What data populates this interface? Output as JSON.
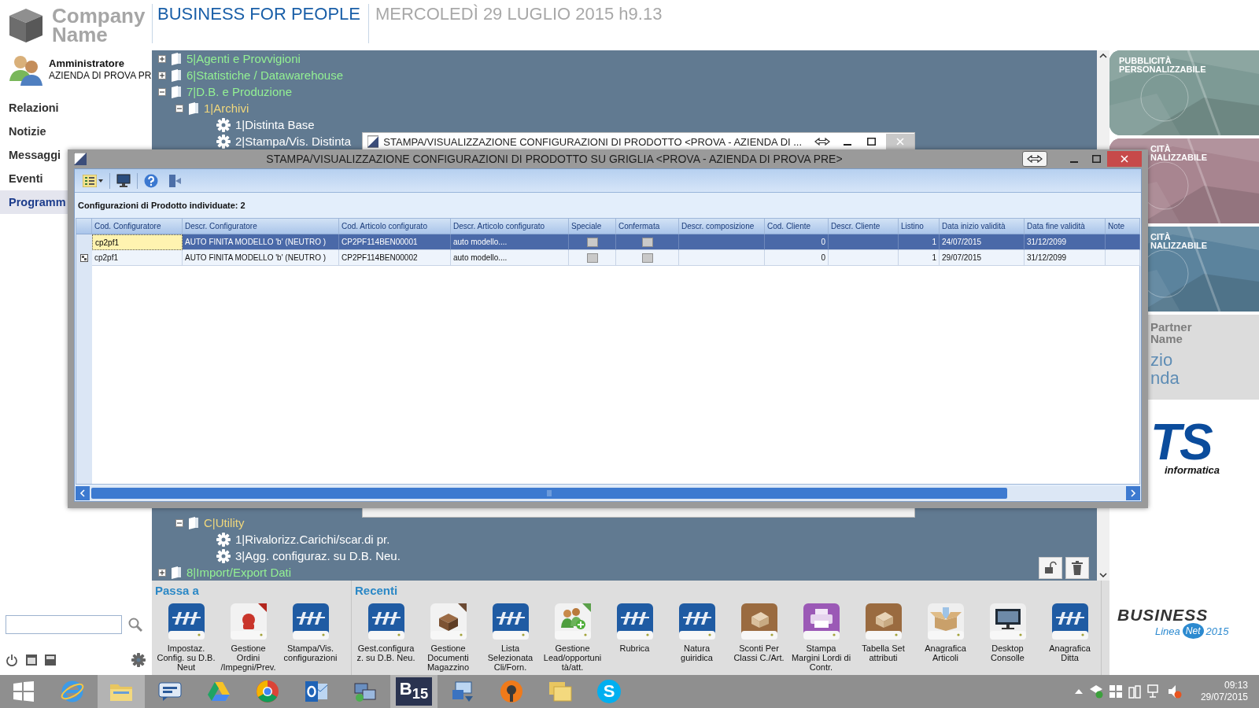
{
  "company_name": "Company Name",
  "header": {
    "slogan": "BUSINESS FOR PEOPLE",
    "date": "MERCOLEDÌ 29 LUGLIO 2015 h9.13"
  },
  "user": {
    "name": "Amministratore",
    "company": "AZIENDA DI PROVA PR"
  },
  "nav": [
    {
      "label": "Relazioni",
      "selected": false
    },
    {
      "label": "Notizie",
      "selected": false
    },
    {
      "label": "Messaggi",
      "selected": false
    },
    {
      "label": "Eventi",
      "selected": false
    },
    {
      "label": "Programm",
      "selected": true
    }
  ],
  "tree": {
    "items": [
      {
        "kind": "folder",
        "label": "5|Agenti e Provvigioni",
        "expanded": false
      },
      {
        "kind": "folder",
        "label": "6|Statistiche / Datawarehouse",
        "expanded": false
      },
      {
        "kind": "folder",
        "label": "7|D.B. e Produzione",
        "expanded": true,
        "children": [
          {
            "kind": "folder",
            "label": "1|Archivi",
            "expanded": true,
            "children": [
              {
                "kind": "program",
                "label": "1|Distinta Base"
              },
              {
                "kind": "program",
                "label": "2|Stampa/Vis. Distinta"
              }
            ]
          },
          {
            "kind": "folder",
            "label": "C|Utility",
            "expanded": true,
            "children": [
              {
                "kind": "program",
                "label": "1|Rivalorizz.Carichi/scar.di pr."
              },
              {
                "kind": "program",
                "label": "3|Agg. configuraz. su D.B. Neu."
              }
            ]
          }
        ]
      },
      {
        "kind": "folder",
        "label": "8|Import/Export Dati",
        "expanded": false
      }
    ]
  },
  "back_window": {
    "title": "STAMPA/VISUALIZZAZIONE CONFIGURAZIONI DI PRODOTTO <PROVA - AZIENDA DI ..."
  },
  "dialog": {
    "title": "STAMPA/VISUALIZZAZIONE CONFIGURAZIONI DI PRODOTTO SU GRIGLIA <PROVA - AZIENDA DI PROVA PRE>",
    "summary": "**Configurazioni di Prodotto individuate:  2**",
    "columns": [
      {
        "label": "Cod. Configuratore",
        "kind": "text"
      },
      {
        "label": "Descr. Configuratore",
        "kind": "text"
      },
      {
        "label": "Cod. Articolo configurato",
        "kind": "text"
      },
      {
        "label": "Descr. Articolo configurato",
        "kind": "text"
      },
      {
        "label": "Speciale",
        "kind": "check"
      },
      {
        "label": "Confermata",
        "kind": "check"
      },
      {
        "label": "Descr. composizione",
        "kind": "text"
      },
      {
        "label": "Cod. Cliente",
        "kind": "number"
      },
      {
        "label": "Descr. Cliente",
        "kind": "text"
      },
      {
        "label": "Listino",
        "kind": "number"
      },
      {
        "label": "Data inizio validità",
        "kind": "text"
      },
      {
        "label": "Data fine validità",
        "kind": "text"
      },
      {
        "label": "Note",
        "kind": "text"
      }
    ],
    "rows": [
      {
        "selected": true,
        "current": true,
        "cells": [
          "cp2pf1",
          "AUTO FINITA MODELLO 'b' (NEUTRO )",
          "CP2PF114BEN00001",
          "auto modello....",
          false,
          false,
          null,
          "0",
          null,
          "1",
          "24/07/2015",
          "31/12/2099",
          null
        ]
      },
      {
        "selected": false,
        "current": false,
        "cells": [
          "cp2pf1",
          "AUTO FINITA MODELLO 'b' (NEUTRO )",
          "CP2PF114BEN00002",
          "auto modello....",
          false,
          false,
          null,
          "0",
          null,
          "1",
          "29/07/2015",
          "31/12/2099",
          null
        ]
      }
    ]
  },
  "dock": [
    {
      "title": "Passa a",
      "items": [
        {
          "label": "Impostaz. Config. su D.B. Neut",
          "kind": "tile"
        },
        {
          "label": "Gestione Ordini /Impegni/Prev.",
          "kind": "order"
        },
        {
          "label": "Stampa/Vis. configurazioni",
          "kind": "tile"
        }
      ]
    },
    {
      "title": "Recenti",
      "items": [
        {
          "label": "Gest.configuraz. su D.B. Neu.",
          "kind": "tile"
        },
        {
          "label": "Gestione Documenti Magazzino",
          "kind": "boxdoc"
        },
        {
          "label": "Lista Selezionata Cli/Forn.",
          "kind": "tile"
        },
        {
          "label": "Gestione Lead/opportunità/att.",
          "kind": "people"
        },
        {
          "label": "Rubrica",
          "kind": "tile"
        },
        {
          "label": "Natura guiridica",
          "kind": "tile"
        },
        {
          "label": "Sconti Per Classi C./Art.",
          "kind": "brownbox"
        },
        {
          "label": "Stampa Margini Lordi di Contr.",
          "kind": "printer"
        },
        {
          "label": "Tabella Set attributi",
          "kind": "brownbox"
        },
        {
          "label": "Anagrafica Articoli",
          "kind": "openbox"
        },
        {
          "label": "Desktop Consolle",
          "kind": "monitor"
        },
        {
          "label": "Anagrafica Ditta",
          "kind": "tile"
        }
      ]
    }
  ],
  "ads": [
    {
      "kind": "promo",
      "color": "#7d9a95",
      "lines": [
        "PUBBLICITÀ",
        "PERSONALIZZABILE"
      ]
    },
    {
      "kind": "promo",
      "color": "#a88590",
      "lines": [
        "CITÀ",
        "NALIZZABILE"
      ]
    },
    {
      "kind": "promo",
      "color": "#5b839d",
      "lines": [
        "CITÀ",
        "NALIZZABILE"
      ]
    },
    {
      "kind": "partner",
      "color": "#dcdcdc",
      "lines": [
        "Partner",
        "Name"
      ],
      "sub_lines": [
        "zio",
        "nda"
      ]
    }
  ],
  "vendor_logo": {
    "mark": "TS",
    "caption": "informatica"
  },
  "product_logo": {
    "name": "BUSINESS",
    "line": "Linea",
    "badge": "Net",
    "year": "2015"
  },
  "taskbar": {
    "apps": [
      {
        "kind": "ie",
        "open": false
      },
      {
        "kind": "folder",
        "open": true
      },
      {
        "kind": "chat",
        "open": false
      },
      {
        "kind": "drive",
        "open": false
      },
      {
        "kind": "chrome",
        "open": false
      },
      {
        "kind": "mail",
        "open": false
      },
      {
        "kind": "network",
        "open": false
      },
      {
        "kind": "b15",
        "label": "B$_{15}$",
        "open": true
      },
      {
        "kind": "remote",
        "open": false
      },
      {
        "kind": "shield",
        "open": false
      },
      {
        "kind": "folders",
        "open": false
      },
      {
        "kind": "skype",
        "label": "S",
        "open": false
      }
    ],
    "time": "09:13",
    "date": "29/07/2015"
  }
}
